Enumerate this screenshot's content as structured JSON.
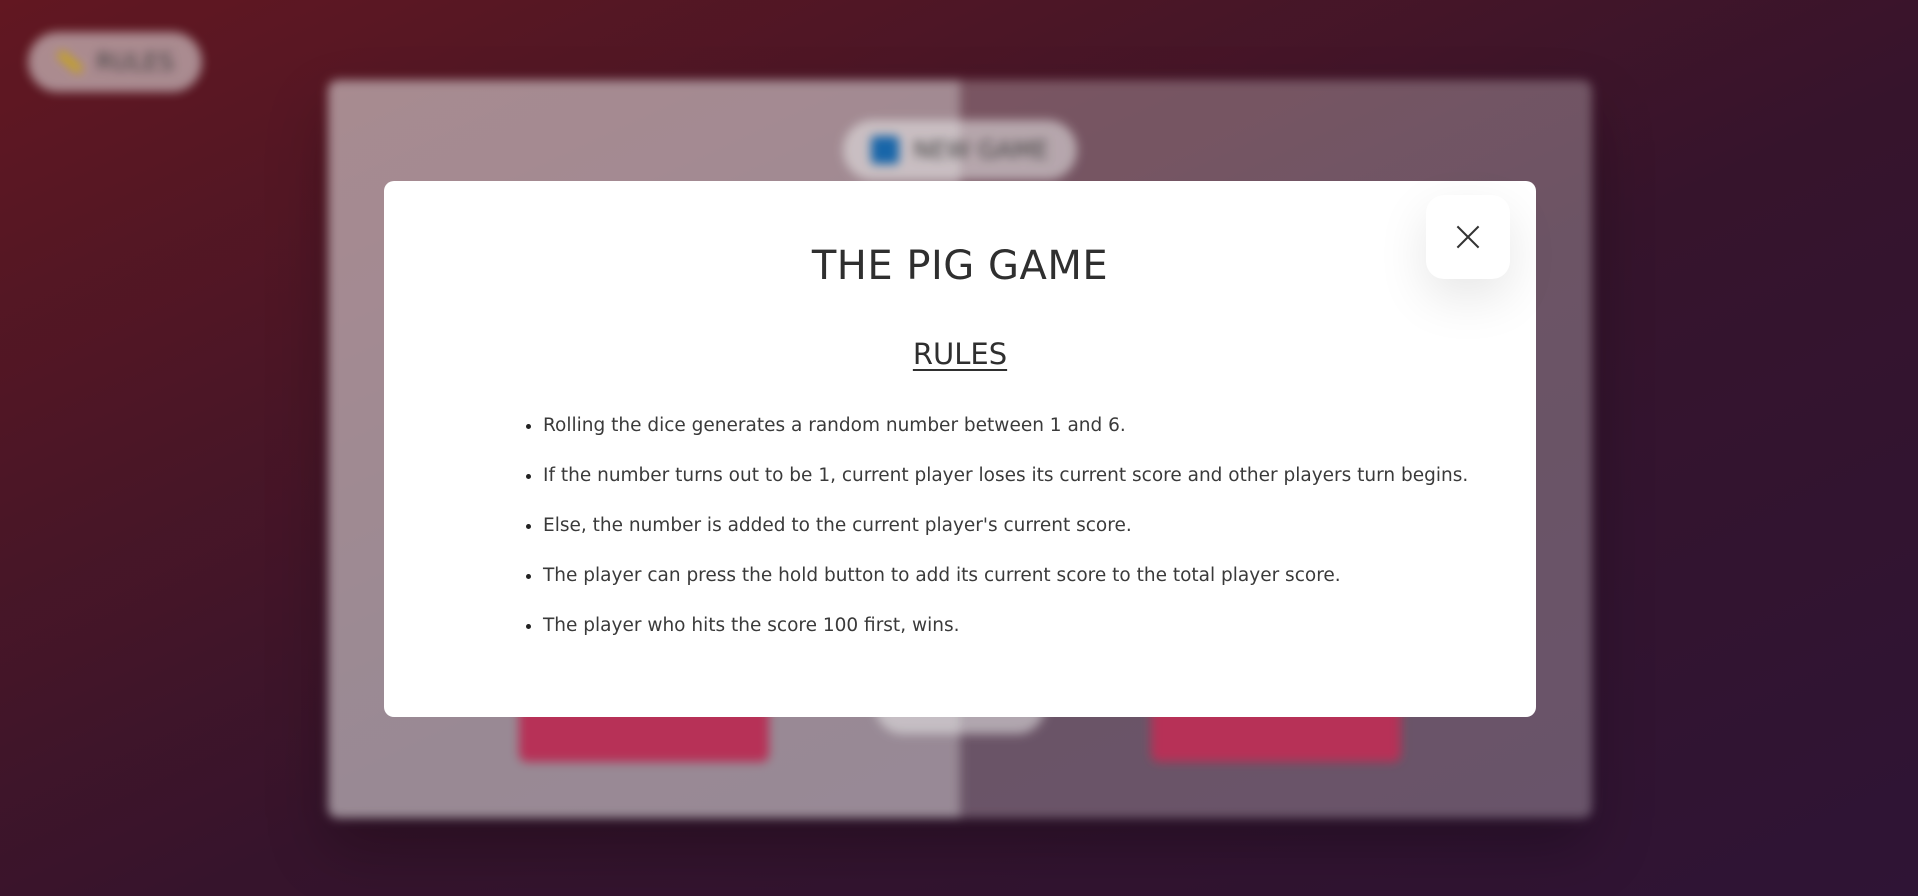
{
  "background": {
    "rules_button": {
      "label": "RULES",
      "icon": "pencil-icon"
    },
    "new_game_button": {
      "label": "NEW GAME",
      "icon": "new-game-icon"
    }
  },
  "modal": {
    "title": "THE PIG GAME",
    "subtitle": "RULES",
    "close_icon": "close-icon",
    "rules": [
      "Rolling the dice generates a random number between 1 and 6.",
      "If the number turns out to be 1, current player loses its current score and other players turn begins.",
      "Else, the number is added to the current player's current score.",
      "The player can press the hold button to add its current score to the total player score.",
      "The player who hits the score 100 first, wins."
    ]
  },
  "colors": {
    "accent_pink": "#c7365f",
    "new_game_icon_blue": "#1b6fb8",
    "pencil_yellow": "#d8b21a",
    "modal_bg": "#ffffff",
    "text": "#333333"
  }
}
